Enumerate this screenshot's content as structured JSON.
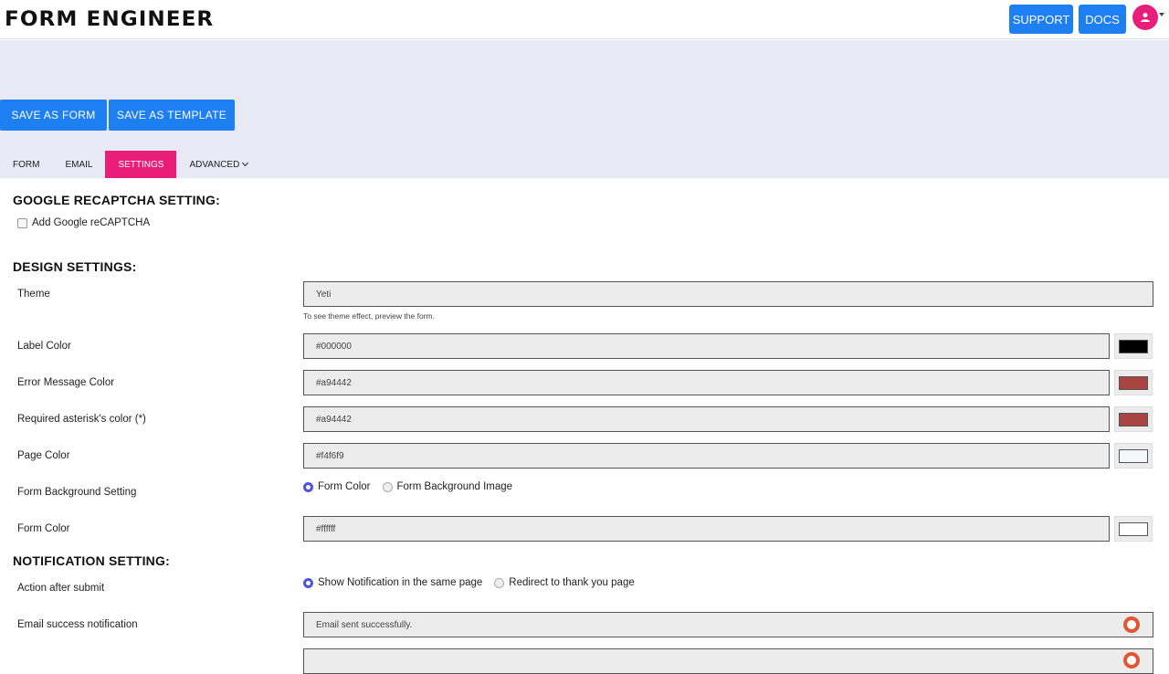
{
  "header": {
    "logo": "FORM ENGINEER",
    "support_label": "SUPPORT",
    "docs_label": "DOCS",
    "avatar_icon": "user-icon"
  },
  "actions": {
    "save_form_label": "SAVE AS FORM",
    "save_template_label": "SAVE AS TEMPLATE"
  },
  "tabs": [
    {
      "label": "FORM",
      "active": false
    },
    {
      "label": "EMAIL",
      "active": false
    },
    {
      "label": "SETTINGS",
      "active": true
    },
    {
      "label": "ADVANCED",
      "active": false
    }
  ],
  "recaptcha": {
    "title": "GOOGLE RECAPTCHA SETTING:",
    "checkbox_label": "Add Google reCAPTCHA",
    "checked": false
  },
  "design": {
    "title": "DESIGN SETTINGS:",
    "theme_label": "Theme",
    "theme_value": "Yeti",
    "theme_hint": "To see theme effect, preview the form.",
    "label_color_label": "Label Color",
    "label_color_value": "#000000",
    "error_color_label": "Error Message Color",
    "error_color_value": "#a94442",
    "asterisk_color_label": "Required asterisk's color (*)",
    "asterisk_color_value": "#a94442",
    "page_color_label": "Page Color",
    "page_color_value": "#f4f6f9",
    "bg_setting_label": "Form Background Setting",
    "bg_option_color": "Form Color",
    "bg_option_image": "Form Background Image",
    "form_color_label": "Form Color",
    "form_color_value": "#ffffff"
  },
  "notification": {
    "title": "NOTIFICATION SETTING:",
    "action_label": "Action after submit",
    "action_option_same": "Show Notification in the same page",
    "action_option_redirect": "Redirect to thank you page",
    "success_label": "Email success notification",
    "success_value": "Email sent successfully."
  },
  "colors": {
    "primary": "#1e7ff2",
    "accent": "#e91e7a",
    "band": "#e8e9f5"
  }
}
